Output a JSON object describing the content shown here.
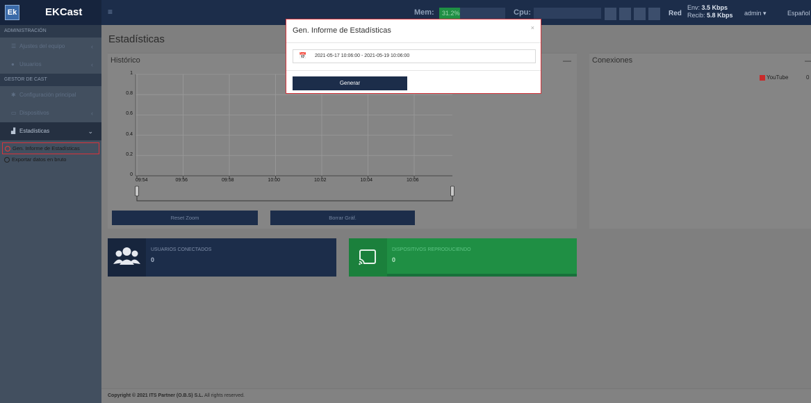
{
  "app": {
    "logo_initials": "Ek",
    "name": "EKCast"
  },
  "header": {
    "menu_toggle": "≡",
    "mem_label": "Mem:",
    "mem_value": "31.2%",
    "mem_percent": 31.2,
    "cpu_label": "Cpu:",
    "red_label": "Red",
    "net_env_label": "Env:",
    "net_env_value": "3.5 Kbps",
    "net_recib_label": "Recib:",
    "net_recib_value": "5.8 Kbps",
    "user": "admin",
    "language": "Español"
  },
  "sidebar": {
    "section_admin": "ADMINISTRACIÓN",
    "item_ajustes": "Ajustes del equipo",
    "item_usuarios": "Usuarios",
    "section_cast": "GESTOR DE CAST",
    "item_config": "Configuración principal",
    "item_dispositivos": "Dispositivos",
    "item_estadisticas": "Estadísticas",
    "sub_gen_informe": "Gen. Informe de Estadísticas",
    "sub_exportar": "Exportar datos en bruto"
  },
  "main": {
    "page_title": "Estadísticas",
    "historico_title": "Histórico",
    "conexiones_title": "Conexiones",
    "minimize_symbol": "—",
    "reset_zoom": "Reset Zoom",
    "borrar_graf": "Borrar Gráf.",
    "usuarios_label": "USUARIOS CONECTADOS",
    "usuarios_value": "0",
    "dispositivos_label": "DISPOSITIVOS REPRODUCIENDO",
    "dispositivos_value": "0",
    "legend_youtube": "YouTube",
    "legend_youtube_value": "0"
  },
  "chart_data": {
    "type": "line",
    "y_ticks": [
      "0",
      "0.2",
      "0.4",
      "0.6",
      "0.8",
      "1"
    ],
    "x_ticks": [
      "09:54",
      "09:56",
      "09:58",
      "10:00",
      "10:02",
      "10:04",
      "10:06"
    ],
    "ylim": [
      0,
      1
    ],
    "grid": true,
    "series": []
  },
  "modal": {
    "title": "Gen. Informe de Estadísticas",
    "close": "×",
    "date_range": "2021-05-17 10:06:00 - 2021-05-19 10:06:00",
    "generate_button": "Generar"
  },
  "footer": {
    "copyright_prefix": "Copyright © 2021",
    "company": "ITS Partner (O.B.S) S.L.",
    "rights": "All rights reserved."
  }
}
